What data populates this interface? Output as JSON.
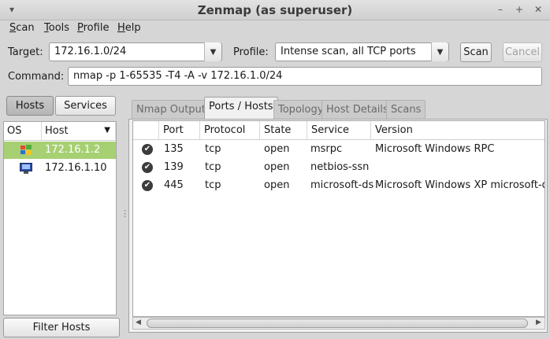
{
  "window": {
    "title": "Zenmap (as superuser)"
  },
  "menu": [
    {
      "mnemonic": "S",
      "rest": "can"
    },
    {
      "mnemonic": "T",
      "rest": "ools"
    },
    {
      "mnemonic": "P",
      "rest": "rofile"
    },
    {
      "mnemonic": "H",
      "rest": "elp"
    }
  ],
  "target": {
    "label": "Target:",
    "value": "172.16.1.0/24"
  },
  "profile": {
    "label": "Profile:",
    "value": "Intense scan, all TCP ports"
  },
  "buttons": {
    "scan": "Scan",
    "cancel": "Cancel",
    "hosts": "Hosts",
    "services": "Services",
    "filter_hosts": "Filter Hosts"
  },
  "command": {
    "label": "Command:",
    "value": "nmap -p 1-65535 -T4 -A -v 172.16.1.0/24"
  },
  "host_list": {
    "columns": [
      "OS",
      "Host"
    ],
    "rows": [
      {
        "host": "172.16.1.2",
        "selected": true
      },
      {
        "host": "172.16.1.10",
        "selected": false
      }
    ]
  },
  "tabs": [
    "Nmap Output",
    "Ports / Hosts",
    "Topology",
    "Host Details",
    "Scans"
  ],
  "active_tab": "Ports / Hosts",
  "ports_table": {
    "columns": [
      "Port",
      "Protocol",
      "State",
      "Service",
      "Version"
    ],
    "rows": [
      {
        "port": "135",
        "protocol": "tcp",
        "state": "open",
        "service": "msrpc",
        "version": "Microsoft Windows RPC"
      },
      {
        "port": "139",
        "protocol": "tcp",
        "state": "open",
        "service": "netbios-ssn",
        "version": ""
      },
      {
        "port": "445",
        "protocol": "tcp",
        "state": "open",
        "service": "microsoft-ds",
        "version": "Microsoft Windows XP microsoft-ds"
      }
    ]
  },
  "colors": {
    "selected_row": "#a7d073",
    "window_bg": "#d6d6d6"
  }
}
